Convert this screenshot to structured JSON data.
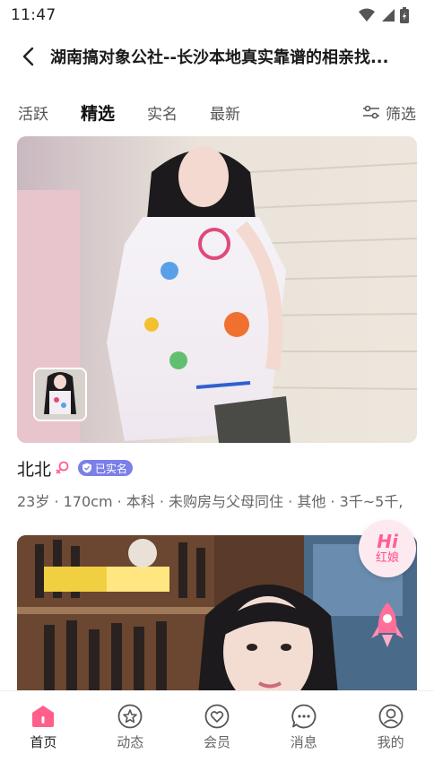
{
  "status_bar": {
    "time": "11:47"
  },
  "header": {
    "title": "湖南搞对象公社--长沙本地真实靠谱的相亲找..."
  },
  "tabs": [
    {
      "label": "活跃"
    },
    {
      "label": "精选"
    },
    {
      "label": "实名"
    },
    {
      "label": "最新"
    }
  ],
  "active_tab": "精选",
  "filter": {
    "label": "筛选"
  },
  "cards": [
    {
      "name": "北北",
      "verified_label": "已实名",
      "info": "23岁 · 170cm · 本科 · 未购房与父母同住 · 其他 · 3千~5千,"
    }
  ],
  "floating": {
    "hi": "Hi",
    "label": "红娘"
  },
  "bottom_nav": [
    {
      "label": "首页"
    },
    {
      "label": "动态"
    },
    {
      "label": "会员"
    },
    {
      "label": "消息"
    },
    {
      "label": "我的"
    }
  ],
  "colors": {
    "accent_pink": "#ff5f93",
    "badge_purple": "#7b7fe8"
  }
}
